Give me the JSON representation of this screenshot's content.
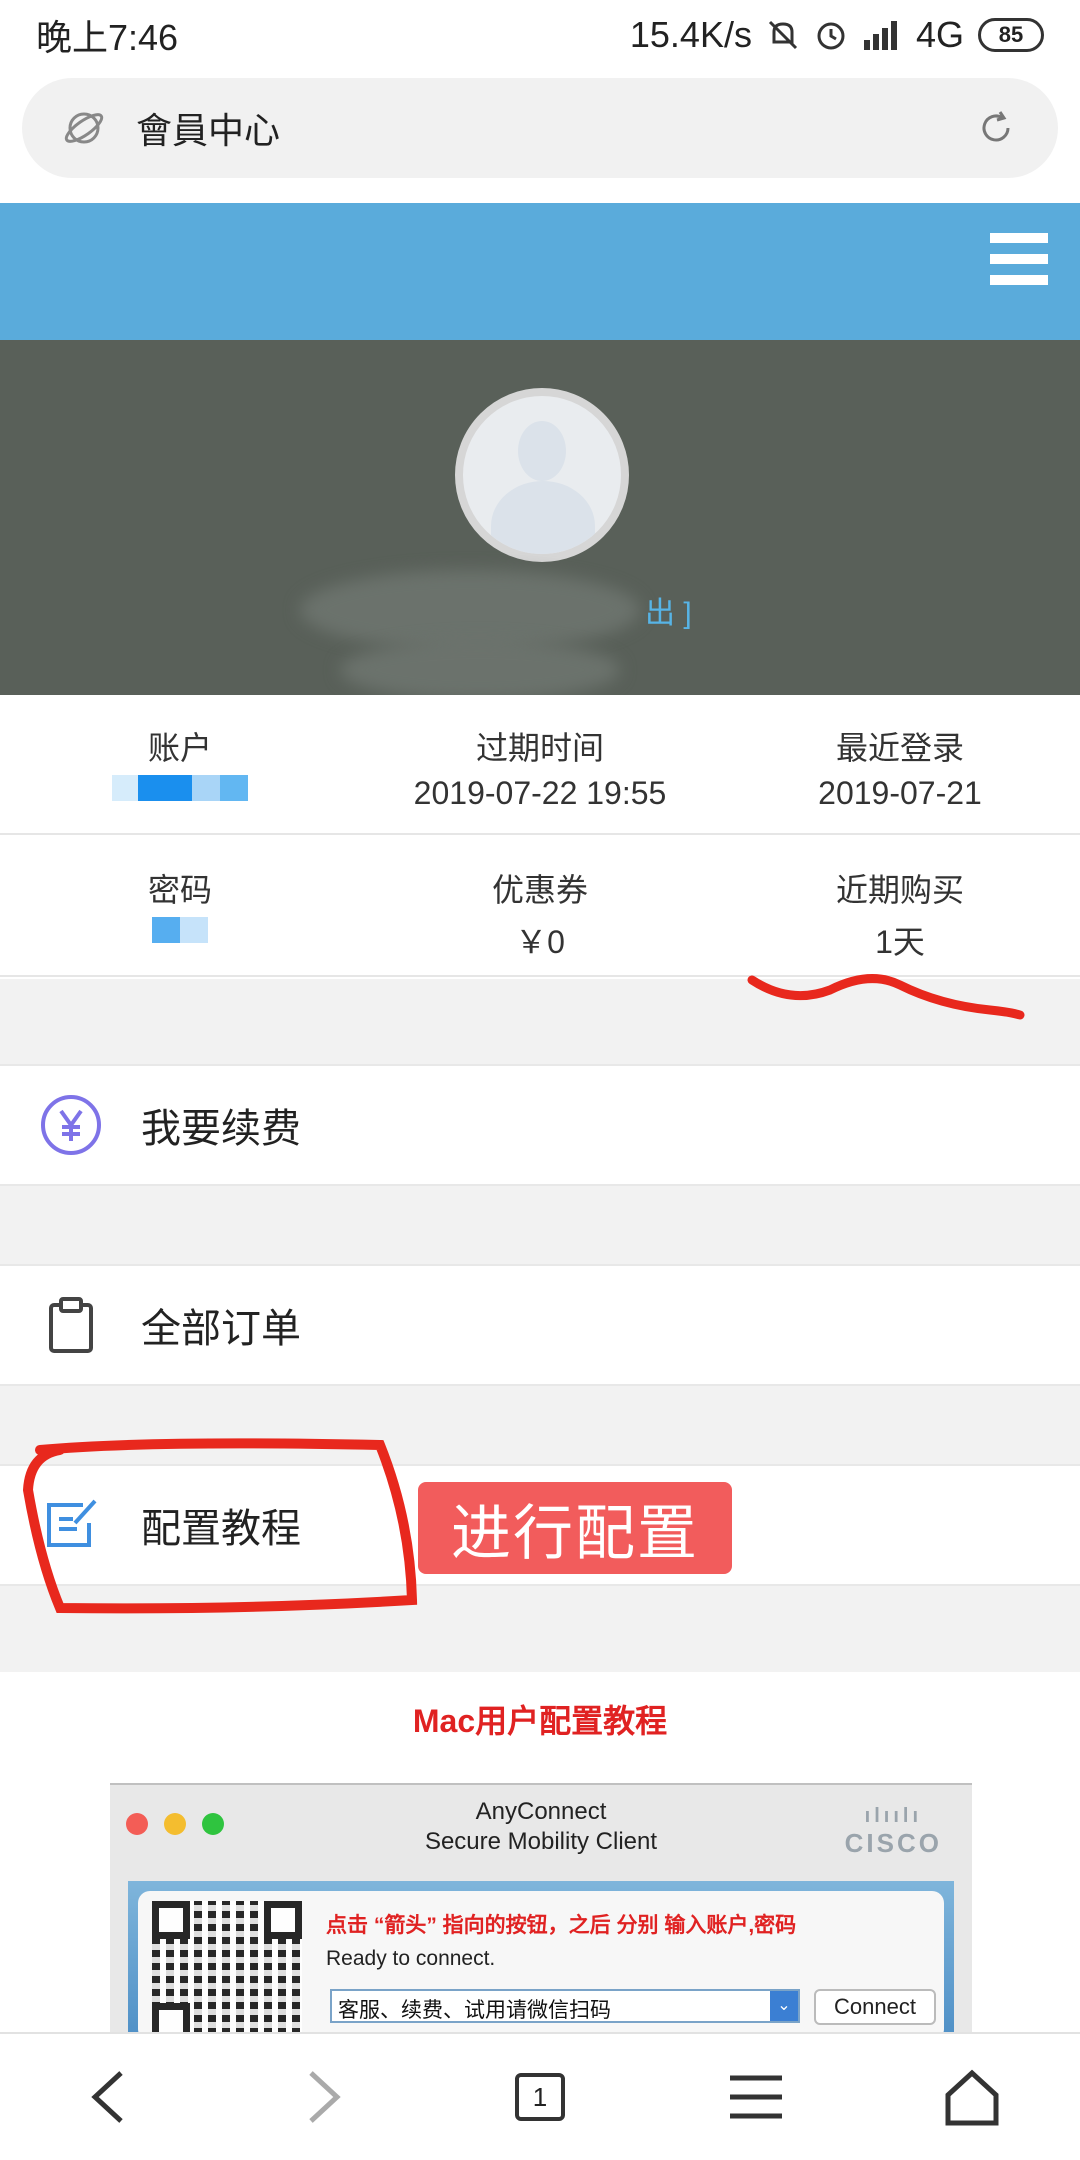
{
  "status_bar": {
    "time": "晚上7:46",
    "net_speed": "15.4K/s",
    "network": "4G",
    "battery": "85"
  },
  "url_bar": {
    "title": "會員中心"
  },
  "profile": {
    "logout_text": "出 ]"
  },
  "stats": {
    "row1": [
      {
        "label": "账户",
        "value": ""
      },
      {
        "label": "过期时间",
        "value": "2019-07-22 19:55"
      },
      {
        "label": "最近登录",
        "value": "2019-07-21"
      }
    ],
    "row2": [
      {
        "label": "密码",
        "value": ""
      },
      {
        "label": "优惠券",
        "value": "￥0"
      },
      {
        "label": "近期购买",
        "value": "1天"
      }
    ]
  },
  "menu": {
    "renew": "我要续费",
    "orders": "全部订单",
    "tutorial": "配置教程"
  },
  "annotation": {
    "badge": "进行配置"
  },
  "tutorial": {
    "title": "Mac用户配置教程",
    "window_title_line1": "AnyConnect",
    "window_title_line2": "Secure Mobility Client",
    "brand": "CISCO",
    "note": "点击 “箭头” 指向的按钮，之后 分别 输入账户,密码",
    "status": "Ready to connect.",
    "dropdown_value": "客服、续费、试用请微信扫码",
    "connect_label": "Connect"
  },
  "bottom_nav": {
    "tab_count": "1"
  },
  "colors": {
    "header": "#5aabdb",
    "profile_bg": "#596059",
    "accent_red": "#e02222",
    "badge_bg": "#f25c5c"
  }
}
